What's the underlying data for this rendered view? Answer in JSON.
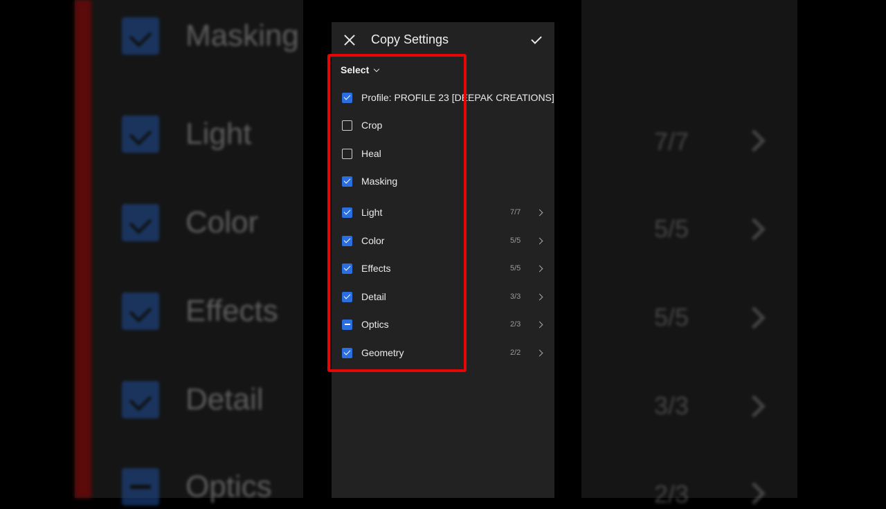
{
  "header": {
    "title": "Copy Settings"
  },
  "select": {
    "label": "Select"
  },
  "items": [
    {
      "label": "Profile: PROFILE 23 [DEEPAK CREATIONS]",
      "state": "checked",
      "count": ""
    },
    {
      "label": "Crop",
      "state": "unchecked",
      "count": ""
    },
    {
      "label": "Heal",
      "state": "unchecked",
      "count": ""
    },
    {
      "label": "Masking",
      "state": "checked",
      "count": ""
    },
    {
      "label": "Light",
      "state": "checked",
      "count": "7/7"
    },
    {
      "label": "Color",
      "state": "checked",
      "count": "5/5"
    },
    {
      "label": "Effects",
      "state": "checked",
      "count": "5/5"
    },
    {
      "label": "Detail",
      "state": "checked",
      "count": "3/3"
    },
    {
      "label": "Optics",
      "state": "partial",
      "count": "2/3"
    },
    {
      "label": "Geometry",
      "state": "checked",
      "count": "2/2"
    }
  ],
  "background": {
    "rows": [
      {
        "label": "Masking",
        "state": "checked",
        "count": ""
      },
      {
        "label": "Light",
        "state": "checked",
        "count": "7/7"
      },
      {
        "label": "Color",
        "state": "checked",
        "count": "5/5"
      },
      {
        "label": "Effects",
        "state": "checked",
        "count": "5/5"
      },
      {
        "label": "Detail",
        "state": "checked",
        "count": "3/3"
      },
      {
        "label": "Optics",
        "state": "partial",
        "count": "2/3"
      }
    ]
  },
  "colors": {
    "accent": "#2a6ee0",
    "highlight": "#e50606",
    "panel": "#222222"
  }
}
